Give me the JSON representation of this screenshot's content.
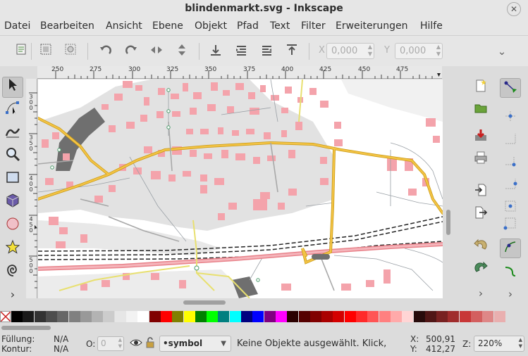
{
  "window": {
    "title": "blindenmarkt.svg - Inkscape",
    "close_glyph": "✕"
  },
  "menu": [
    "Datei",
    "Bearbeiten",
    "Ansicht",
    "Ebene",
    "Objekt",
    "Pfad",
    "Text",
    "Filter",
    "Erweiterungen",
    "Hilfe"
  ],
  "toolbar": {
    "x_label": "X",
    "x_value": "0,000",
    "y_label": "Y",
    "y_value": "0,000",
    "overflow_glyph": "⌄"
  },
  "ruler": {
    "h_labels": [
      "250",
      "275",
      "300",
      "325",
      "350",
      "375",
      "400",
      "425",
      "450",
      "475"
    ],
    "v_labels": [
      "3\n0\n0",
      "3\n5\n0",
      "4\n0\n0",
      "4\n5\n0",
      "5\n0\n0"
    ]
  },
  "tools_more_glyph": "›",
  "status": {
    "fill_label": "Füllung:",
    "fill_value": "N/A",
    "stroke_label": "Kontur:",
    "stroke_value": "N/A",
    "opacity_label": "O:",
    "opacity_value": "0",
    "layer": "•symbol",
    "message": "Keine Objekte ausgewählt. Klick,",
    "x_label": "X:",
    "x_value": "500,91",
    "y_label": "Y:",
    "y_value": "412,27",
    "zoom_label": "Z:",
    "zoom_value": "220%"
  },
  "palette_colors": [
    "#000000",
    "#1a1a1a",
    "#333333",
    "#4d4d4d",
    "#666666",
    "#808080",
    "#999999",
    "#b3b3b3",
    "#cccccc",
    "#e6e6e6",
    "#f2f2f2",
    "#ffffff",
    "#800000",
    "#ff0000",
    "#808000",
    "#ffff00",
    "#008000",
    "#00ff00",
    "#008080",
    "#00ffff",
    "#000080",
    "#0000ff",
    "#800080",
    "#ff00ff",
    "#2b0000",
    "#550000",
    "#800000",
    "#aa0000",
    "#d40000",
    "#ff0000",
    "#ff2a2a",
    "#ff5555",
    "#ff8080",
    "#ffaaaa",
    "#ffd5d5",
    "#280b0b",
    "#501616",
    "#782121",
    "#a02c2c",
    "#c83737",
    "#d35f5f",
    "#de8787",
    "#e9afaf"
  ]
}
